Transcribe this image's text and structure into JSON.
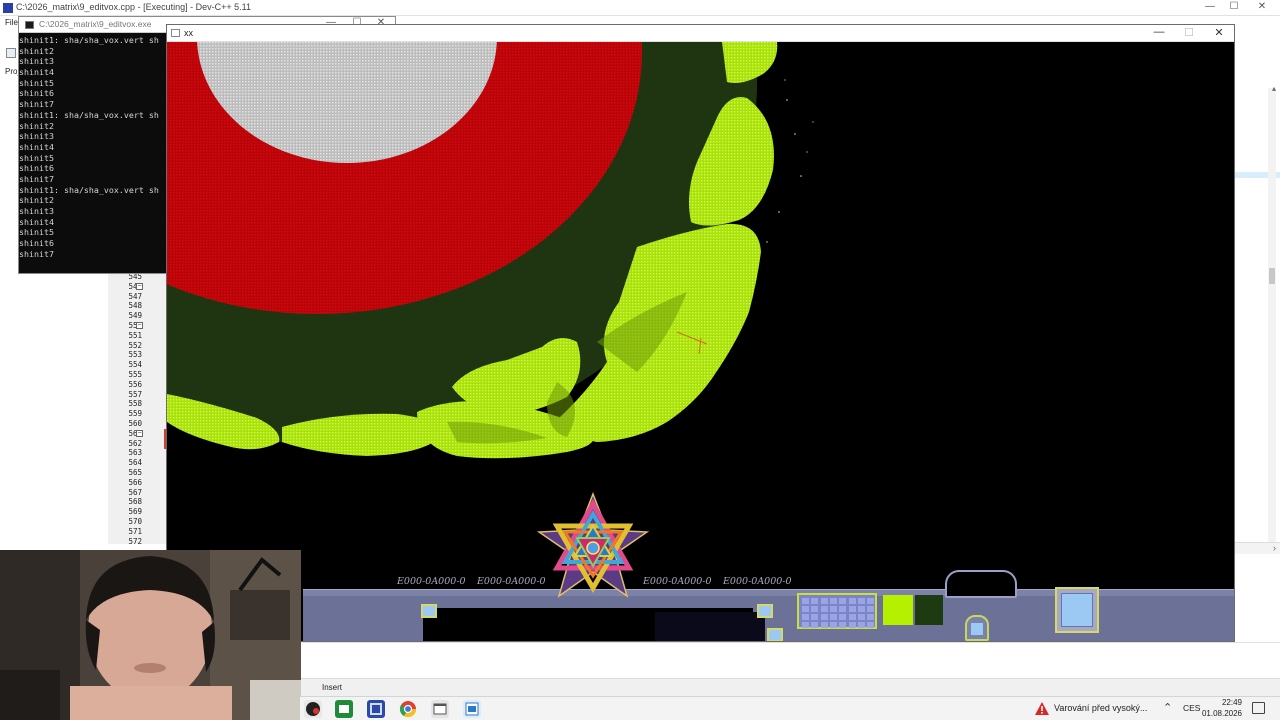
{
  "ide": {
    "title": "C:\\2026_matrix\\9_editvox.cpp - [Executing] - Dev-C++ 5.11",
    "menu_file": "File",
    "project_tab": "Proj",
    "status_mode": "Insert",
    "line_numbers": [
      "545",
      "546",
      "547",
      "548",
      "549",
      "550",
      "551",
      "552",
      "553",
      "554",
      "555",
      "556",
      "557",
      "558",
      "559",
      "560",
      "561",
      "562",
      "563",
      "564",
      "565",
      "566",
      "567",
      "568",
      "569",
      "570",
      "571",
      "572"
    ],
    "window_controls": {
      "minimize": "—",
      "maximize": "☐",
      "close": "✕"
    }
  },
  "console": {
    "title": "C:\\2026_matrix\\9_editvox.exe",
    "lines": [
      "shinit1: sha/sha_vox.vert sh",
      "shinit2",
      "shinit3",
      "shinit4",
      "shinit5",
      "shinit6",
      "shinit7",
      "shinit1: sha/sha_vox.vert sh",
      "shinit2",
      "shinit3",
      "shinit4",
      "shinit5",
      "shinit6",
      "shinit7",
      "shinit1: sha/sha_vox.vert sh",
      "shinit2",
      "shinit3",
      "shinit4",
      "shinit5",
      "shinit6",
      "shinit7"
    ],
    "window_controls": {
      "minimize": "—",
      "maximize": "☐",
      "close": "✕"
    }
  },
  "game": {
    "title": "xx",
    "window_controls": {
      "minimize": "—",
      "maximize": "☐",
      "close": "✕"
    },
    "hud": {
      "readouts": [
        "E000-0A000-0",
        "E000-0A000-0",
        "E000-0A000-0",
        "E000-0A000-0"
      ]
    },
    "colors": {
      "voxel_lime": "#b7ee12",
      "dark_green": "#1f3410",
      "red_ring": "#c4050b",
      "grey_sphere": "#c9c9c9",
      "hud_panel": "#6b7197"
    }
  },
  "taskbar": {
    "warning_text": "Varování před vysoký...",
    "language": "CES",
    "time": "22:49",
    "date": "01.08.2026",
    "icons": [
      "record-icon",
      "terminal-icon",
      "devcpp-icon",
      "chrome-icon",
      "window-icon",
      "editor-icon"
    ]
  }
}
